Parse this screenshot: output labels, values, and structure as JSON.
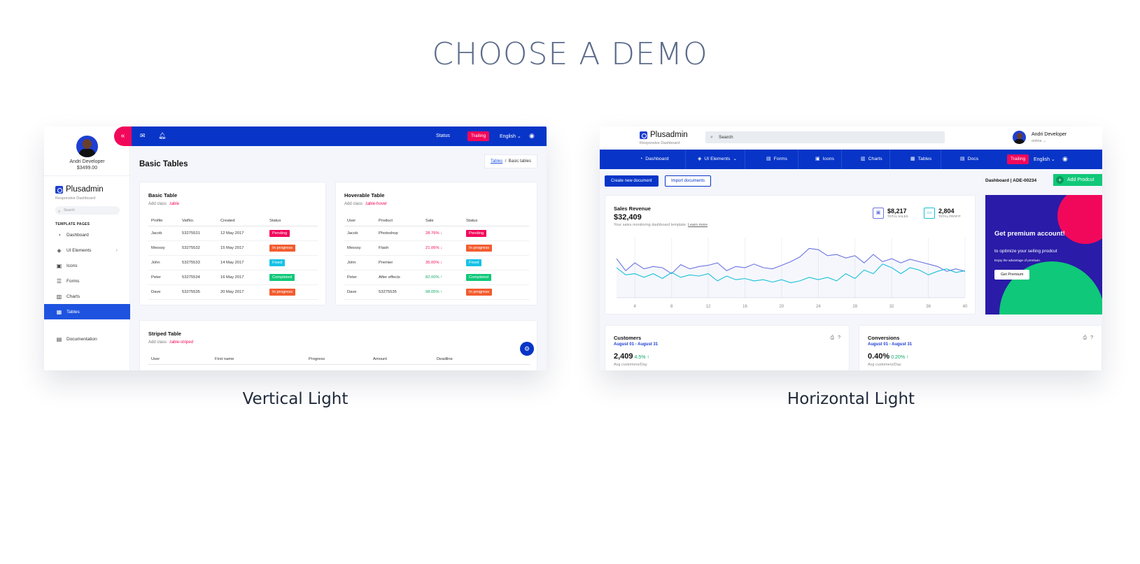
{
  "page": {
    "title": "CHOOSE A DEMO"
  },
  "demos": [
    {
      "caption": "Vertical Light",
      "user": {
        "name": "Andri Developer",
        "balance": "$3499.00"
      },
      "logo": "Plusadmin",
      "tagline": "Responsive Dashboard",
      "search_placeholder": "Search",
      "section_label": "TEMPLATE PAGES",
      "menu": [
        {
          "label": "Dashboard",
          "icon": "dashboard-icon"
        },
        {
          "label": "UI Elements",
          "icon": "diamond-icon",
          "has_submenu": true
        },
        {
          "label": "Icons",
          "icon": "icons-icon"
        },
        {
          "label": "Forms",
          "icon": "list-icon"
        },
        {
          "label": "Charts",
          "icon": "bar-chart-icon"
        },
        {
          "label": "Tables",
          "icon": "table-icon",
          "active": true
        }
      ],
      "menu_bottom": {
        "label": "Documentation",
        "icon": "document-icon"
      },
      "topbar": {
        "status": "Status",
        "trail": "Trailing",
        "lang": "English"
      },
      "heading": "Basic Tables",
      "breadcrumb": {
        "link": "Tables",
        "current": "Basic tables"
      },
      "basic_table": {
        "title": "Basic Table",
        "add_class_label": "Add class",
        "class_name": ".table",
        "headers": [
          "Profile",
          "VatNo.",
          "Created",
          "Status"
        ],
        "rows": [
          [
            "Jacob",
            "53275531",
            "12 May 2017",
            "Pending"
          ],
          [
            "Messsy",
            "53275532",
            "15 May 2017",
            "In progress"
          ],
          [
            "John",
            "53275533",
            "14 May 2017",
            "Fixed"
          ],
          [
            "Peter",
            "53275534",
            "16 May 2017",
            "Completed"
          ],
          [
            "Dave",
            "53275535",
            "20 May 2017",
            "In progress"
          ]
        ]
      },
      "hoverable_table": {
        "title": "Hoverable Table",
        "add_class_label": "Add class",
        "class_name": ".table-hover",
        "headers": [
          "User",
          "Product",
          "Sale",
          "Status"
        ],
        "rows": [
          [
            "Jacob",
            "Photoshop",
            "28.76% ↓",
            "Pending"
          ],
          [
            "Messsy",
            "Flash",
            "21.06% ↓",
            "In progress"
          ],
          [
            "John",
            "Premier",
            "35.00% ↓",
            "Fixed"
          ],
          [
            "Peter",
            "After effects",
            "82.00% ↑",
            "Completed"
          ],
          [
            "Dave",
            "53275535",
            "98.05% ↑",
            "In progress"
          ]
        ]
      },
      "striped_table": {
        "title": "Striped Table",
        "add_class_label": "Add class",
        "class_name": ".table-striped",
        "headers": [
          "User",
          "First name",
          "Progress",
          "Amount",
          "Deadline"
        ]
      },
      "colors": {
        "primary": "#0835c8",
        "accent": "#f2085b",
        "active": "#1e53e0"
      }
    },
    {
      "caption": "Horizontal Light",
      "logo": "Plusadmin",
      "tagline": "Responsive Dashboard",
      "search_placeholder": "Search",
      "user": {
        "name": "Andri Developer",
        "status": "online"
      },
      "nav": [
        {
          "label": "Dashboard",
          "icon": "dashboard-icon"
        },
        {
          "label": "UI Elements",
          "icon": "diamond-icon",
          "has_submenu": true
        },
        {
          "label": "Forms",
          "icon": "forms-icon"
        },
        {
          "label": "Icons",
          "icon": "icons-icon"
        },
        {
          "label": "Charts",
          "icon": "bar-chart-icon"
        },
        {
          "label": "Tables",
          "icon": "table-icon"
        },
        {
          "label": "Docs",
          "icon": "document-icon"
        }
      ],
      "nav_right": {
        "trail": "Trailing",
        "lang": "English"
      },
      "actions": {
        "create": "Create new document",
        "import": "Import documents",
        "breadcrumb": "Dashboard   |   ADE-00234",
        "add_product": "Add Prodcut"
      },
      "sales_revenue": {
        "title": "Sales Revenue",
        "value": "$32,409",
        "desc": "Your sales monitoring dashboard template.",
        "learn_more": "Learn more",
        "total_sales_value": "$8,217",
        "total_sales_label": "TOTAL SALES",
        "total_profit_value": "2,804",
        "total_profit_label": "TOTAL PROFIT"
      },
      "promo": {
        "title": "Get premium account!",
        "subtitle": "to optimize your selling prodcut",
        "note": "Enjoy the advantage of premium.",
        "button": "Get Premium"
      },
      "customers": {
        "title": "Customers",
        "range": "August 01 - August 31",
        "value": "2,409",
        "change": "4.5%",
        "sub": "Avg customers/Day"
      },
      "conversions": {
        "title": "Conversions",
        "range": "August 01 - August 31",
        "value": "0.40%",
        "change": "0.20%",
        "sub": "Avg customers/Day"
      },
      "colors": {
        "primary": "#0835c8",
        "accent": "#f2085b",
        "success": "#10c879",
        "promo_bg": "#2a1ba8"
      }
    }
  ],
  "chart_data": {
    "type": "line",
    "x": [
      2,
      3,
      4,
      5,
      6,
      7,
      8,
      9,
      10,
      11,
      12,
      13,
      14,
      15,
      16,
      17,
      18,
      19,
      20,
      21,
      22,
      23,
      24,
      25,
      26,
      27,
      28,
      29,
      30,
      31,
      32,
      33,
      34,
      35,
      36,
      37,
      38,
      39,
      40
    ],
    "xticks": [
      4,
      8,
      12,
      16,
      20,
      24,
      28,
      32,
      36,
      40
    ],
    "xlim": [
      2,
      40
    ],
    "ylim": [
      0,
      100
    ],
    "grid": true,
    "legend": "none",
    "series": [
      {
        "color": "#6c74e0",
        "values": [
          65,
          45,
          58,
          48,
          52,
          50,
          40,
          55,
          48,
          52,
          54,
          58,
          45,
          52,
          50,
          56,
          50,
          48,
          54,
          60,
          68,
          82,
          80,
          70,
          72,
          66,
          70,
          58,
          72,
          60,
          65,
          58,
          64,
          60,
          56,
          52,
          44,
          48,
          44
        ]
      },
      {
        "color": "#16c2d6",
        "values": [
          50,
          38,
          40,
          34,
          40,
          32,
          42,
          34,
          38,
          36,
          40,
          28,
          36,
          30,
          32,
          28,
          30,
          26,
          30,
          25,
          28,
          34,
          30,
          34,
          28,
          40,
          32,
          46,
          40,
          56,
          50,
          40,
          50,
          46,
          38,
          44,
          48,
          42,
          45
        ]
      }
    ]
  }
}
